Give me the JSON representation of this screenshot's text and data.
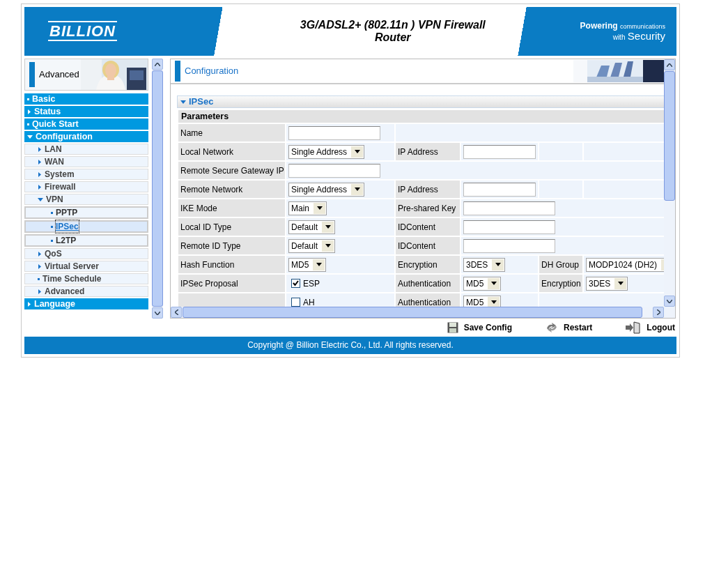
{
  "header": {
    "logo": "BILLION",
    "title": "3G/ADSL2+ (802.11n ) VPN Firewall Router",
    "tagline": [
      "Powering",
      "communications",
      "with",
      "Security"
    ]
  },
  "sidebar": {
    "banner": "Advanced",
    "items": [
      {
        "label": "Basic",
        "kind": "page",
        "selected": false
      },
      {
        "label": "Status",
        "kind": "group",
        "expanded": false,
        "selected": false
      },
      {
        "label": "Quick Start",
        "kind": "page",
        "selected": false
      },
      {
        "label": "Configuration",
        "kind": "group",
        "expanded": true,
        "selected": false,
        "children": [
          {
            "label": "LAN",
            "kind": "group",
            "expanded": false,
            "selected": false
          },
          {
            "label": "WAN",
            "kind": "group",
            "expanded": false,
            "selected": false
          },
          {
            "label": "System",
            "kind": "group",
            "expanded": false,
            "selected": false
          },
          {
            "label": "Firewall",
            "kind": "group",
            "expanded": false,
            "selected": false
          },
          {
            "label": "VPN",
            "kind": "group",
            "expanded": true,
            "selected": false,
            "children": [
              {
                "label": "PPTP",
                "kind": "page",
                "selected": false
              },
              {
                "label": "IPSec",
                "kind": "page",
                "selected": true
              },
              {
                "label": "L2TP",
                "kind": "page",
                "selected": false
              }
            ]
          },
          {
            "label": "QoS",
            "kind": "group",
            "expanded": false,
            "selected": false
          },
          {
            "label": "Virtual Server",
            "kind": "group",
            "expanded": false,
            "selected": false
          },
          {
            "label": "Time Schedule",
            "kind": "page",
            "selected": false
          },
          {
            "label": "Advanced",
            "kind": "group",
            "expanded": false,
            "selected": false
          }
        ]
      },
      {
        "label": "Language",
        "kind": "group",
        "expanded": false,
        "selected": false
      }
    ]
  },
  "main": {
    "heading": "Configuration",
    "section": {
      "title": "IPSec",
      "expanded": true
    },
    "subheading": "Parameters",
    "rows": [
      [
        {
          "kind": "label",
          "text": "Name"
        },
        {
          "kind": "input"
        },
        {
          "kind": "empty"
        }
      ],
      [
        {
          "kind": "label",
          "text": "Local Network"
        },
        {
          "kind": "select",
          "value": "Single Address"
        },
        {
          "kind": "label",
          "text": "IP Address"
        },
        {
          "kind": "input"
        },
        {
          "kind": "empty"
        },
        {
          "kind": "empty"
        }
      ],
      [
        {
          "kind": "label",
          "text": "Remote Secure Gateway IP"
        },
        {
          "kind": "input"
        }
      ],
      [
        {
          "kind": "label",
          "text": "Remote Network"
        },
        {
          "kind": "select",
          "value": "Single Address"
        },
        {
          "kind": "label",
          "text": "IP Address"
        },
        {
          "kind": "input"
        },
        {
          "kind": "empty"
        },
        {
          "kind": "empty"
        }
      ],
      [
        {
          "kind": "label",
          "text": "IKE Mode"
        },
        {
          "kind": "select",
          "value": "Main"
        },
        {
          "kind": "label",
          "text": "Pre-shared Key"
        },
        {
          "kind": "input"
        }
      ],
      [
        {
          "kind": "label",
          "text": "Local ID Type"
        },
        {
          "kind": "select",
          "value": "Default"
        },
        {
          "kind": "label",
          "text": "IDContent"
        },
        {
          "kind": "input"
        }
      ],
      [
        {
          "kind": "label",
          "text": "Remote ID Type"
        },
        {
          "kind": "select",
          "value": "Default"
        },
        {
          "kind": "label",
          "text": "IDContent"
        },
        {
          "kind": "input"
        }
      ],
      [
        {
          "kind": "label",
          "text": "Hash Function"
        },
        {
          "kind": "select",
          "value": "MD5"
        },
        {
          "kind": "label",
          "text": "Encryption"
        },
        {
          "kind": "select",
          "value": "3DES"
        },
        {
          "kind": "label",
          "text": "DH Group"
        },
        {
          "kind": "select",
          "value": "MODP1024 (DH2)"
        }
      ],
      [
        {
          "kind": "label",
          "text": "IPSec Proposal"
        },
        {
          "kind": "checkbox",
          "text": "ESP",
          "checked": true
        },
        {
          "kind": "label",
          "text": "Authentication"
        },
        {
          "kind": "select",
          "value": "MD5"
        },
        {
          "kind": "label",
          "text": "Encryption"
        },
        {
          "kind": "select",
          "value": "3DES"
        }
      ],
      [
        {
          "kind": "label"
        },
        {
          "kind": "checkbox",
          "text": "AH",
          "checked": false
        },
        {
          "kind": "label",
          "text": "Authentication"
        },
        {
          "kind": "select",
          "value": "MD5"
        },
        {
          "kind": "empty"
        }
      ]
    ]
  },
  "actions": [
    {
      "kind": "save",
      "label": "Save Config"
    },
    {
      "kind": "restart",
      "label": "Restart"
    },
    {
      "kind": "logout",
      "label": "Logout"
    }
  ],
  "copyright": "Copyright @ Billion Electric Co., Ltd. All rights reserved."
}
